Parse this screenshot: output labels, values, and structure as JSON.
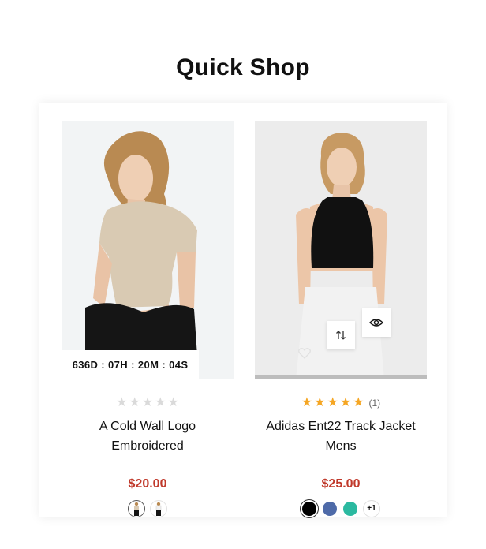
{
  "page": {
    "heading": "Quick Shop"
  },
  "products": [
    {
      "name_line1": "A Cold Wall Logo",
      "name_line2": "Embroidered",
      "price": "$20.00",
      "rating": 0,
      "review_count": "",
      "countdown": "636D : 07H : 20M : 04S",
      "image_icon": "model-beige-tshirt-photo",
      "swatch_thumbnails": [
        "beige-tee-look-thumbnail",
        "white-tee-look-thumbnail"
      ]
    },
    {
      "name_line1": "Adidas Ent22 Track Jacket",
      "name_line2": "Mens",
      "price": "$25.00",
      "rating": 5,
      "review_count": "(1)",
      "stock_progress": 0.0,
      "image_icon": "model-black-crop-top-photo",
      "actions": [
        "compare-icon",
        "quick-view-eye-icon",
        "wishlist-heart-icon"
      ],
      "colors": [
        "#000000",
        "#4e6aa8",
        "#2bb9a0"
      ],
      "more_colors": "+1"
    }
  ],
  "colors": {
    "price": "#c0392b",
    "star": "#f5a623",
    "star_empty": "#dadada"
  }
}
